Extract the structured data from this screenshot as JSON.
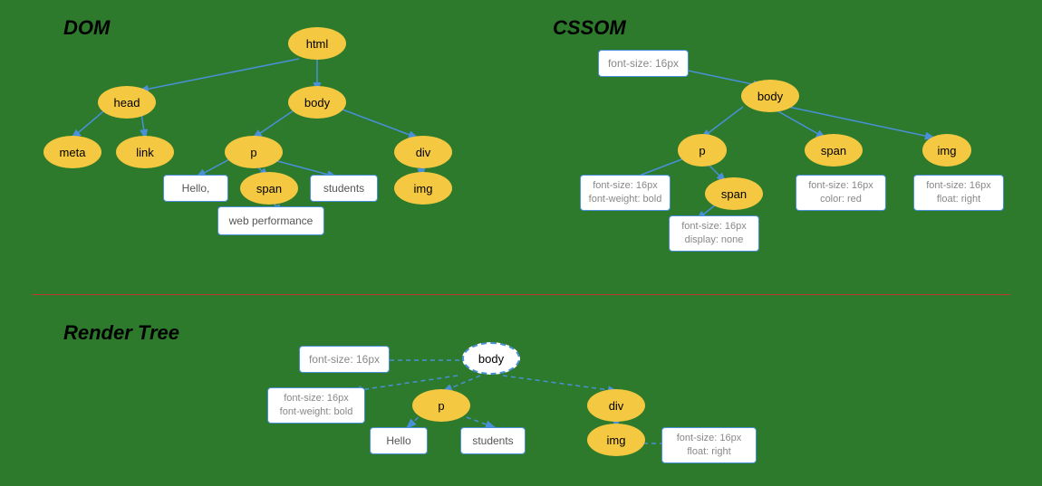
{
  "sections": {
    "dom_title": "DOM",
    "cssom_title": "CSSOM",
    "render_title": "Render Tree"
  },
  "dom_nodes": {
    "html": "html",
    "head": "head",
    "body": "body",
    "meta": "meta",
    "link": "link",
    "p": "p",
    "div": "div",
    "span": "span",
    "img": "img"
  },
  "dom_rects": {
    "hello": "Hello,",
    "students": "students",
    "web_performance": "web performance"
  },
  "cssom_nodes": {
    "body": "body",
    "p": "p",
    "span1": "span",
    "img": "img",
    "span2": "span"
  },
  "cssom_rects": {
    "root": "font-size: 16px",
    "p": "font-size: 16px\nfont-weight: bold",
    "span1": "font-size: 16px\ncolor: red",
    "img": "font-size: 16px\nfloat: right",
    "span2": "font-size: 16px\ndisplay: none"
  },
  "render_nodes": {
    "body": "body",
    "p": "p",
    "div": "div",
    "img": "img"
  },
  "render_rects": {
    "fontsize": "font-size: 16px",
    "p_styles": "font-size: 16px\nfont-weight: bold",
    "hello": "Hello",
    "students": "students",
    "img_styles": "font-size: 16px\nfloat: right"
  }
}
